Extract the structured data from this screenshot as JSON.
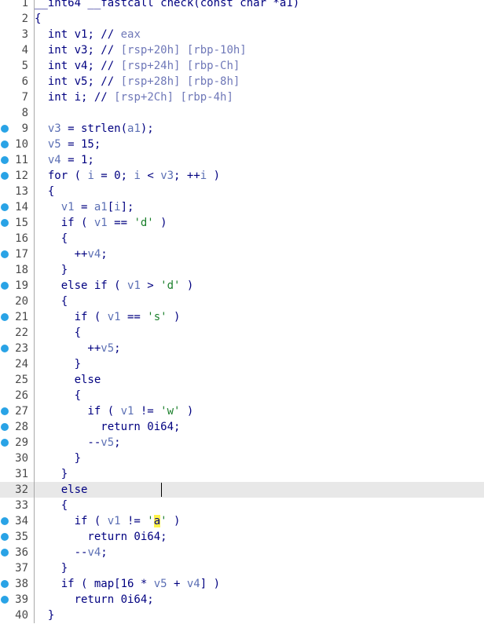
{
  "editor": {
    "function_name": "check",
    "current_line": 32,
    "lines": [
      {
        "n": "1",
        "bp": false,
        "tokens": [
          {
            "t": "__int64 __fastcall check(const char *a1)",
            "c": "txt"
          }
        ]
      },
      {
        "n": "2",
        "bp": false,
        "tokens": [
          {
            "t": "{",
            "c": "pun"
          }
        ]
      },
      {
        "n": "3",
        "bp": false,
        "tokens": [
          {
            "t": "  int ",
            "c": "kw"
          },
          {
            "t": "v1",
            "c": "txt"
          },
          {
            "t": "; // ",
            "c": "pun"
          },
          {
            "t": "eax",
            "c": "com"
          }
        ]
      },
      {
        "n": "4",
        "bp": false,
        "tokens": [
          {
            "t": "  int ",
            "c": "kw"
          },
          {
            "t": "v3",
            "c": "txt"
          },
          {
            "t": "; // ",
            "c": "pun"
          },
          {
            "t": "[rsp+20h] [rbp-10h]",
            "c": "com"
          }
        ]
      },
      {
        "n": "5",
        "bp": false,
        "tokens": [
          {
            "t": "  int ",
            "c": "kw"
          },
          {
            "t": "v4",
            "c": "txt"
          },
          {
            "t": "; // ",
            "c": "pun"
          },
          {
            "t": "[rsp+24h] [rbp-Ch]",
            "c": "com"
          }
        ]
      },
      {
        "n": "6",
        "bp": false,
        "tokens": [
          {
            "t": "  int ",
            "c": "kw"
          },
          {
            "t": "v5",
            "c": "txt"
          },
          {
            "t": "; // ",
            "c": "pun"
          },
          {
            "t": "[rsp+28h] [rbp-8h]",
            "c": "com"
          }
        ]
      },
      {
        "n": "7",
        "bp": false,
        "tokens": [
          {
            "t": "  int ",
            "c": "kw"
          },
          {
            "t": "i",
            "c": "txt"
          },
          {
            "t": "; // ",
            "c": "pun"
          },
          {
            "t": "[rsp+2Ch] [rbp-4h]",
            "c": "com"
          }
        ]
      },
      {
        "n": "8",
        "bp": false,
        "tokens": []
      },
      {
        "n": "9",
        "bp": true,
        "tokens": [
          {
            "t": "  ",
            "c": "txt"
          },
          {
            "t": "v3",
            "c": "id"
          },
          {
            "t": " = strlen(",
            "c": "txt"
          },
          {
            "t": "a1",
            "c": "id"
          },
          {
            "t": ");",
            "c": "pun"
          }
        ]
      },
      {
        "n": "10",
        "bp": true,
        "tokens": [
          {
            "t": "  ",
            "c": "txt"
          },
          {
            "t": "v5",
            "c": "id"
          },
          {
            "t": " = 15;",
            "c": "txt"
          }
        ]
      },
      {
        "n": "11",
        "bp": true,
        "tokens": [
          {
            "t": "  ",
            "c": "txt"
          },
          {
            "t": "v4",
            "c": "id"
          },
          {
            "t": " = 1;",
            "c": "txt"
          }
        ]
      },
      {
        "n": "12",
        "bp": true,
        "tokens": [
          {
            "t": "  for ( ",
            "c": "kw"
          },
          {
            "t": "i",
            "c": "id"
          },
          {
            "t": " = 0; ",
            "c": "txt"
          },
          {
            "t": "i",
            "c": "id"
          },
          {
            "t": " < ",
            "c": "txt"
          },
          {
            "t": "v3",
            "c": "id"
          },
          {
            "t": "; ++",
            "c": "txt"
          },
          {
            "t": "i",
            "c": "id"
          },
          {
            "t": " )",
            "c": "txt"
          }
        ]
      },
      {
        "n": "13",
        "bp": false,
        "tokens": [
          {
            "t": "  {",
            "c": "pun"
          }
        ]
      },
      {
        "n": "14",
        "bp": true,
        "tokens": [
          {
            "t": "    ",
            "c": "txt"
          },
          {
            "t": "v1",
            "c": "id"
          },
          {
            "t": " = ",
            "c": "txt"
          },
          {
            "t": "a1",
            "c": "id"
          },
          {
            "t": "[",
            "c": "txt"
          },
          {
            "t": "i",
            "c": "id"
          },
          {
            "t": "];",
            "c": "txt"
          }
        ]
      },
      {
        "n": "15",
        "bp": true,
        "tokens": [
          {
            "t": "    if ( ",
            "c": "kw"
          },
          {
            "t": "v1",
            "c": "id"
          },
          {
            "t": " == ",
            "c": "txt"
          },
          {
            "t": "'d'",
            "c": "str"
          },
          {
            "t": " )",
            "c": "txt"
          }
        ]
      },
      {
        "n": "16",
        "bp": false,
        "tokens": [
          {
            "t": "    {",
            "c": "pun"
          }
        ]
      },
      {
        "n": "17",
        "bp": true,
        "tokens": [
          {
            "t": "      ++",
            "c": "txt"
          },
          {
            "t": "v4",
            "c": "id"
          },
          {
            "t": ";",
            "c": "pun"
          }
        ]
      },
      {
        "n": "18",
        "bp": false,
        "tokens": [
          {
            "t": "    }",
            "c": "pun"
          }
        ]
      },
      {
        "n": "19",
        "bp": true,
        "tokens": [
          {
            "t": "    else if ( ",
            "c": "kw"
          },
          {
            "t": "v1",
            "c": "id"
          },
          {
            "t": " > ",
            "c": "txt"
          },
          {
            "t": "'d'",
            "c": "str"
          },
          {
            "t": " )",
            "c": "txt"
          }
        ]
      },
      {
        "n": "20",
        "bp": false,
        "tokens": [
          {
            "t": "    {",
            "c": "pun"
          }
        ]
      },
      {
        "n": "21",
        "bp": true,
        "tokens": [
          {
            "t": "      if ( ",
            "c": "kw"
          },
          {
            "t": "v1",
            "c": "id"
          },
          {
            "t": " == ",
            "c": "txt"
          },
          {
            "t": "'s'",
            "c": "str"
          },
          {
            "t": " )",
            "c": "txt"
          }
        ]
      },
      {
        "n": "22",
        "bp": false,
        "tokens": [
          {
            "t": "      {",
            "c": "pun"
          }
        ]
      },
      {
        "n": "23",
        "bp": true,
        "tokens": [
          {
            "t": "        ++",
            "c": "txt"
          },
          {
            "t": "v5",
            "c": "id"
          },
          {
            "t": ";",
            "c": "pun"
          }
        ]
      },
      {
        "n": "24",
        "bp": false,
        "tokens": [
          {
            "t": "      }",
            "c": "pun"
          }
        ]
      },
      {
        "n": "25",
        "bp": false,
        "tokens": [
          {
            "t": "      else",
            "c": "kw"
          }
        ]
      },
      {
        "n": "26",
        "bp": false,
        "tokens": [
          {
            "t": "      {",
            "c": "pun"
          }
        ]
      },
      {
        "n": "27",
        "bp": true,
        "tokens": [
          {
            "t": "        if ( ",
            "c": "kw"
          },
          {
            "t": "v1",
            "c": "id"
          },
          {
            "t": " != ",
            "c": "txt"
          },
          {
            "t": "'w'",
            "c": "str"
          },
          {
            "t": " )",
            "c": "txt"
          }
        ]
      },
      {
        "n": "28",
        "bp": true,
        "tokens": [
          {
            "t": "          return 0i64;",
            "c": "kw"
          }
        ]
      },
      {
        "n": "29",
        "bp": true,
        "tokens": [
          {
            "t": "        --",
            "c": "txt"
          },
          {
            "t": "v5",
            "c": "id"
          },
          {
            "t": ";",
            "c": "pun"
          }
        ]
      },
      {
        "n": "30",
        "bp": false,
        "tokens": [
          {
            "t": "      }",
            "c": "pun"
          }
        ]
      },
      {
        "n": "31",
        "bp": false,
        "tokens": [
          {
            "t": "    }",
            "c": "pun"
          }
        ]
      },
      {
        "n": "32",
        "bp": false,
        "tokens": [
          {
            "t": "    else",
            "c": "kw"
          }
        ]
      },
      {
        "n": "33",
        "bp": false,
        "tokens": [
          {
            "t": "    {",
            "c": "pun"
          }
        ]
      },
      {
        "n": "34",
        "bp": true,
        "tokens": [
          {
            "t": "      if ( ",
            "c": "kw"
          },
          {
            "t": "v1",
            "c": "id"
          },
          {
            "t": " != ",
            "c": "txt"
          },
          {
            "t": "'",
            "c": "str"
          },
          {
            "t": "a",
            "c": "hl"
          },
          {
            "t": "'",
            "c": "str"
          },
          {
            "t": " )",
            "c": "txt"
          }
        ]
      },
      {
        "n": "35",
        "bp": true,
        "tokens": [
          {
            "t": "        return 0i64;",
            "c": "kw"
          }
        ]
      },
      {
        "n": "36",
        "bp": true,
        "tokens": [
          {
            "t": "      --",
            "c": "txt"
          },
          {
            "t": "v4",
            "c": "id"
          },
          {
            "t": ";",
            "c": "pun"
          }
        ]
      },
      {
        "n": "37",
        "bp": false,
        "tokens": [
          {
            "t": "    }",
            "c": "pun"
          }
        ]
      },
      {
        "n": "38",
        "bp": true,
        "tokens": [
          {
            "t": "    if ( map[16 * ",
            "c": "kw"
          },
          {
            "t": "v5",
            "c": "id"
          },
          {
            "t": " + ",
            "c": "txt"
          },
          {
            "t": "v4",
            "c": "id"
          },
          {
            "t": "] )",
            "c": "txt"
          }
        ]
      },
      {
        "n": "39",
        "bp": true,
        "tokens": [
          {
            "t": "      return 0i64;",
            "c": "kw"
          }
        ]
      },
      {
        "n": "40",
        "bp": false,
        "tokens": [
          {
            "t": "  }",
            "c": "pun"
          }
        ]
      }
    ]
  },
  "colors": {
    "breakpoint": "#29a3e6",
    "current_line": "#e8e8e8",
    "search_highlight": "#fff34a"
  }
}
